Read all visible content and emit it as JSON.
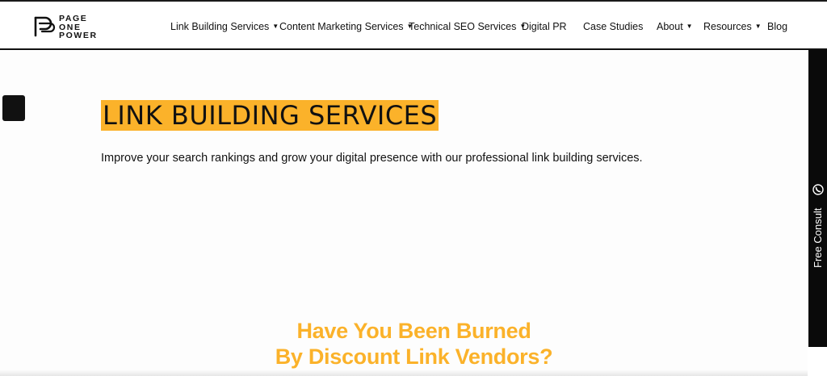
{
  "brand": {
    "logo_lines": [
      "PAGE",
      "ONE",
      "POWER"
    ],
    "accent_color": "#fbb22a",
    "text_color": "#111111"
  },
  "nav": {
    "items": [
      {
        "label": "Link Building Services",
        "has_dropdown": true
      },
      {
        "label": "Content Marketing Services",
        "has_dropdown": true
      },
      {
        "label": "Technical SEO Services",
        "has_dropdown": true
      },
      {
        "label": "Digital PR",
        "has_dropdown": false
      },
      {
        "label": "Case Studies",
        "has_dropdown": false
      },
      {
        "label": "About",
        "has_dropdown": true
      },
      {
        "label": "Resources",
        "has_dropdown": true
      },
      {
        "label": "Blog",
        "has_dropdown": false
      }
    ],
    "caret_glyph": "▼"
  },
  "hero": {
    "title": "LINK BUILDING SERVICES",
    "subtitle": "Improve your search rankings and grow your digital presence with our professional link building services."
  },
  "section": {
    "heading_line1": "Have You Been Burned",
    "heading_line2": "By Discount Link Vendors?"
  },
  "side_cta": {
    "label": "Free Consult",
    "icon": "phone-icon",
    "background": "#0a0a0a"
  }
}
